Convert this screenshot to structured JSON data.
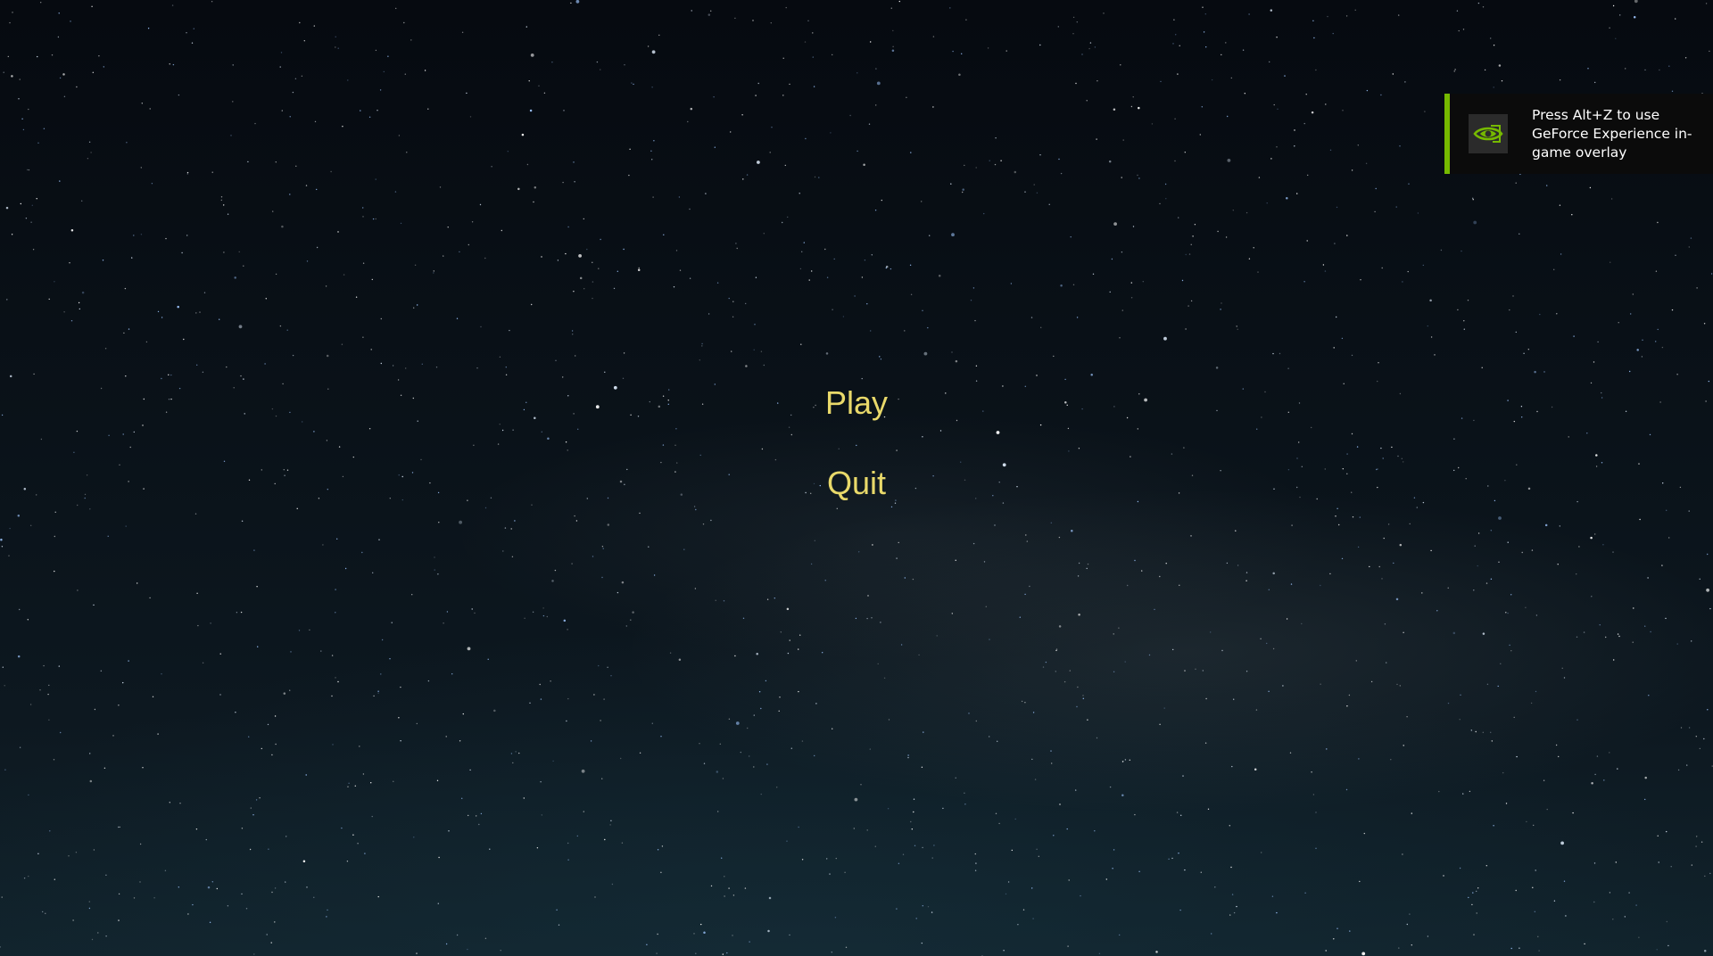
{
  "menu": {
    "play_label": "Play",
    "quit_label": "Quit",
    "text_color": "#e9d96a"
  },
  "overlay_notification": {
    "message": "Press Alt+Z to use GeForce Experience in-game overlay",
    "icon": "nvidia-eye-icon",
    "accent_color": "#76b900"
  },
  "background": {
    "scene": "starry-night-sky"
  }
}
